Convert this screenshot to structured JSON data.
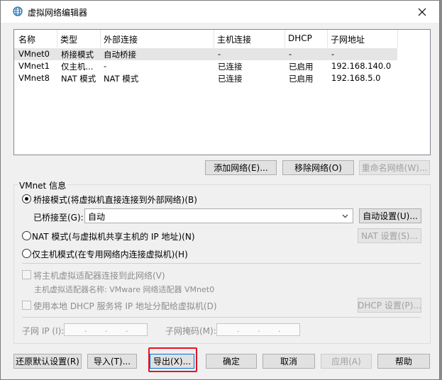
{
  "window": {
    "title": "虚拟网络编辑器"
  },
  "list": {
    "headers": [
      "名称",
      "类型",
      "外部连接",
      "主机连接",
      "DHCP",
      "子网地址"
    ],
    "rows": [
      [
        "VMnet0",
        "桥接模式",
        "自动桥接",
        "-",
        "-",
        "-"
      ],
      [
        "VMnet1",
        "仅主机...",
        "-",
        "已连接",
        "已启用",
        "192.168.140.0"
      ],
      [
        "VMnet8",
        "NAT 模式",
        "NAT 模式",
        "已连接",
        "已启用",
        "192.168.5.0"
      ]
    ]
  },
  "list_buttons": {
    "add": "添加网络(E)...",
    "remove": "移除网络(O)",
    "rename": "重命名网络(W)..."
  },
  "vmnet_info": {
    "group_label": "VMnet 信息",
    "bridged_label": "桥接模式(将虚拟机直接连接到外部网络)(B)",
    "bridged_to_label": "已桥接至(G):",
    "bridged_to_value": "自动",
    "auto_settings": "自动设置(U)...",
    "nat_label": "NAT 模式(与虚拟机共享主机的 IP 地址)(N)",
    "nat_settings": "NAT 设置(S)...",
    "hostonly_label": "仅主机模式(在专用网络内连接虚拟机)(H)",
    "connect_adapter_label": "将主机虚拟适配器连接到此网络(V)",
    "adapter_name_label": "主机虚拟适配器名称: VMware 网络适配器 VMnet0",
    "dhcp_label": "使用本地 DHCP 服务将 IP 地址分配给虚拟机(D)",
    "dhcp_settings": "DHCP 设置(P)...",
    "subnet_ip_label": "子网 IP (I):",
    "subnet_mask_label": "子网掩码(M):",
    "ip_dots": "."
  },
  "footer": {
    "restore": "还原默认设置(R)",
    "import": "导入(T)...",
    "export": "导出(X)...",
    "ok": "确定",
    "cancel": "取消",
    "apply": "应用(A)",
    "help": "帮助"
  },
  "colors": {
    "highlight": "#e81123",
    "focus": "#0078d7",
    "selected_row": "#e5e5e5"
  }
}
